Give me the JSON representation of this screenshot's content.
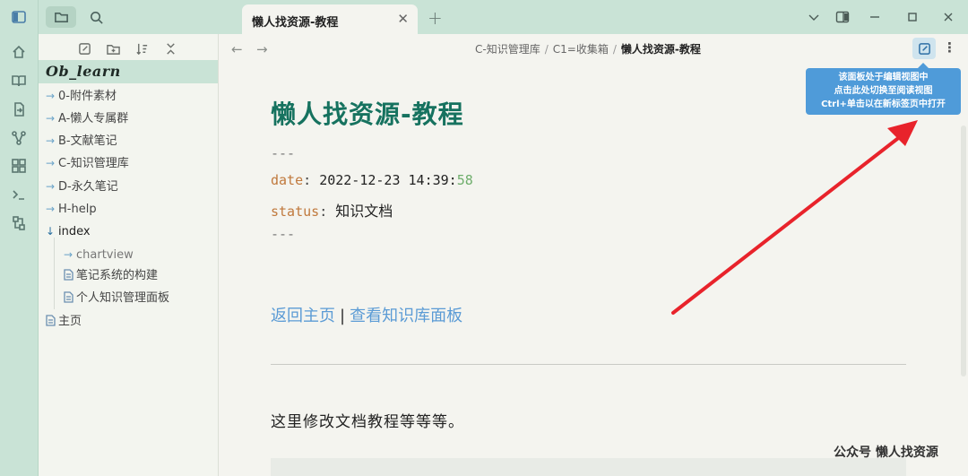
{
  "ribbon": {
    "icons": [
      "sidebar-toggle-icon",
      "home-icon",
      "book-icon",
      "file-import-icon",
      "graph-icon",
      "dashboard-icon",
      "terminal-icon",
      "plugin-icon"
    ]
  },
  "sidebar": {
    "tabs": [
      "folder-icon",
      "search-icon"
    ],
    "tools": [
      "new-note-icon",
      "new-folder-icon",
      "sort-icon",
      "collapse-icon"
    ],
    "vault_name": "Ob_learn",
    "items": [
      {
        "label": "0-附件素材",
        "type": "folder",
        "expanded": false
      },
      {
        "label": "A-懒人专属群",
        "type": "folder",
        "expanded": false
      },
      {
        "label": "B-文献笔记",
        "type": "folder",
        "expanded": false
      },
      {
        "label": "C-知识管理库",
        "type": "folder",
        "expanded": false
      },
      {
        "label": "D-永久笔记",
        "type": "folder",
        "expanded": false
      },
      {
        "label": "H-help",
        "type": "folder",
        "expanded": false
      },
      {
        "label": "index",
        "type": "folder",
        "expanded": true
      },
      {
        "label": "chartview",
        "type": "folder",
        "expanded": false
      },
      {
        "label": "笔记系统的构建",
        "type": "file"
      },
      {
        "label": "个人知识管理面板",
        "type": "file"
      },
      {
        "label": "主页",
        "type": "file"
      }
    ]
  },
  "tabbar": {
    "active_tab": "懒人找资源-教程",
    "close": "✕",
    "new_tab": "+"
  },
  "navbar": {
    "back": "←",
    "forward": "→",
    "breadcrumb": [
      "C-知识管理库",
      "C1=收集箱",
      "懒人找资源-教程"
    ],
    "sep": "/",
    "more": "⋮"
  },
  "tooltip": {
    "line1": "该面板处于编辑视图中",
    "line2": "点击此处切换至阅读视图",
    "line3": "Ctrl+单击以在新标签页中打开"
  },
  "document": {
    "title": "懒人找资源-教程",
    "frontmatter_delim": "---",
    "date_key": "date",
    "date_val": "2022-12-23 14:39:",
    "date_sec": "58",
    "status_key": "status",
    "status_val": "知识文档",
    "colon": ":",
    "link1": "返回主页",
    "link_sep": "|",
    "link2": "查看知识库面板",
    "paragraph": "这里修改文档教程等等等。"
  },
  "watermark": "公众号  懒人找资源",
  "colors": {
    "accent_green": "#c9e3d6",
    "title_green": "#16725f",
    "link_blue": "#5b9bd5",
    "arrow_red": "#e8232b",
    "tooltip_blue": "#4f9bd9"
  }
}
